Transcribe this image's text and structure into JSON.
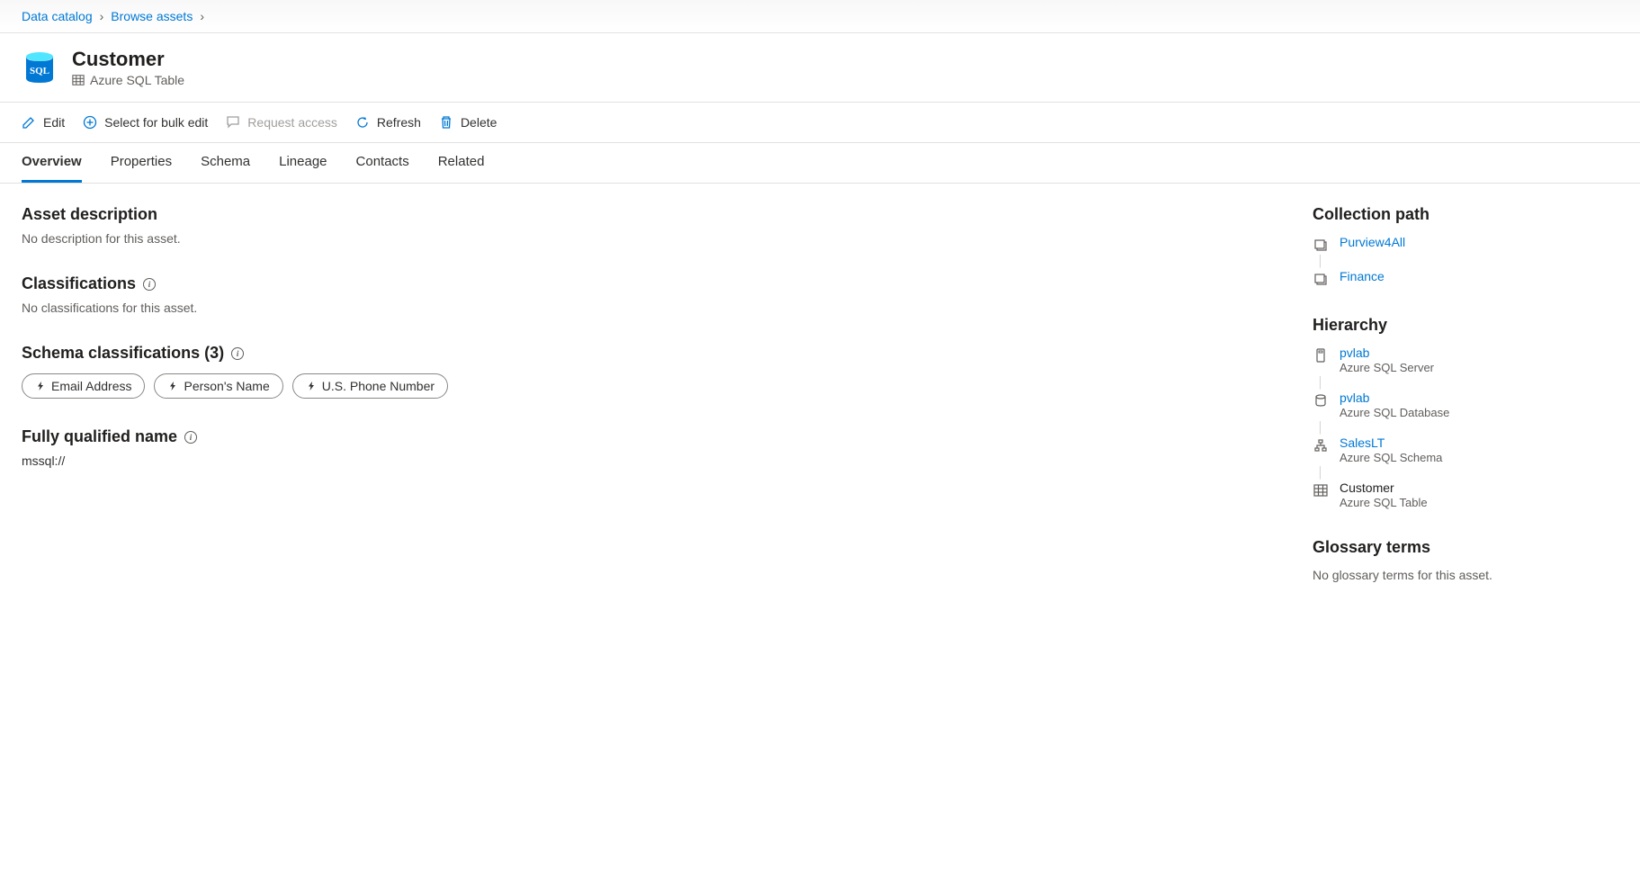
{
  "breadcrumb": {
    "items": [
      "Data catalog",
      "Browse assets"
    ]
  },
  "header": {
    "title": "Customer",
    "subtitle": "Azure SQL Table"
  },
  "toolbar": {
    "edit": "Edit",
    "bulk": "Select for bulk edit",
    "request": "Request access",
    "refresh": "Refresh",
    "delete": "Delete"
  },
  "tabs": [
    "Overview",
    "Properties",
    "Schema",
    "Lineage",
    "Contacts",
    "Related"
  ],
  "activeTab": "Overview",
  "main": {
    "desc_title": "Asset description",
    "desc_text": "No description for this asset.",
    "class_title": "Classifications",
    "class_text": "No classifications for this asset.",
    "schema_class_title": "Schema classifications (3)",
    "schema_classifications": [
      "Email Address",
      "Person's Name",
      "U.S. Phone Number"
    ],
    "fqn_title": "Fully qualified name",
    "fqn_value": "mssql://"
  },
  "side": {
    "collection_title": "Collection path",
    "collection_path": [
      "Purview4All",
      "Finance"
    ],
    "hierarchy_title": "Hierarchy",
    "hierarchy": [
      {
        "name": "pvlab",
        "type": "Azure SQL Server",
        "link": true,
        "icon": "server"
      },
      {
        "name": "pvlab",
        "type": "Azure SQL Database",
        "link": true,
        "icon": "database"
      },
      {
        "name": "SalesLT",
        "type": "Azure SQL Schema",
        "link": true,
        "icon": "schema"
      },
      {
        "name": "Customer",
        "type": "Azure SQL Table",
        "link": false,
        "icon": "table"
      }
    ],
    "glossary_title": "Glossary terms",
    "glossary_text": "No glossary terms for this asset."
  }
}
